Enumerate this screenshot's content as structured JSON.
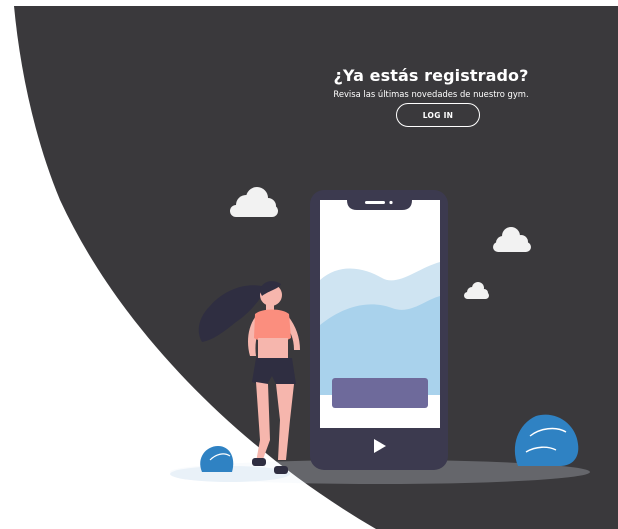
{
  "panel": {
    "title": "¿Ya estás registrado?",
    "subtitle": "Revisa las últimas novedades de nuestro gym.",
    "login_label": "LOG IN"
  },
  "illustration": {
    "icons": [
      "cloud-icon",
      "cloud-icon",
      "cloud-icon",
      "bush-icon",
      "bush-icon",
      "play-icon"
    ],
    "colors": {
      "background_panel": "#3a393c",
      "phone": "#3c3a4f",
      "screen": "#ffffff",
      "mountain_back": "#cfe4f2",
      "mountain_front": "#a9d2ec",
      "phone_button": "#6e6a9b",
      "hair": "#2f2e41",
      "top": "#fb8e7e",
      "skin": "#f6b6ad",
      "shorts": "#2f2e41",
      "bush": "#2f82c3"
    }
  }
}
